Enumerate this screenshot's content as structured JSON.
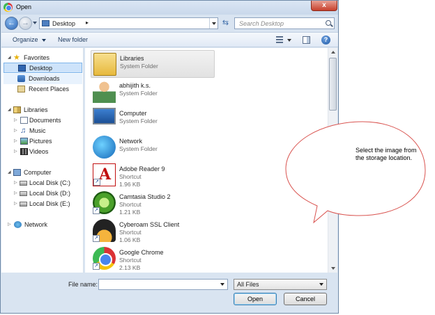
{
  "window": {
    "title": "Open",
    "close_label": "x"
  },
  "address": {
    "path": "Desktop",
    "chevron": "▸",
    "search_placeholder": "Search Desktop"
  },
  "toolbar": {
    "organize_label": "Organize",
    "new_folder_label": "New folder",
    "help_label": "?"
  },
  "nav": {
    "favorites": "Favorites",
    "desktop": "Desktop",
    "downloads": "Downloads",
    "recent": "Recent Places",
    "libraries": "Libraries",
    "documents": "Documents",
    "music": "Music",
    "pictures": "Pictures",
    "videos": "Videos",
    "computer": "Computer",
    "disk_c": "Local Disk (C:)",
    "disk_d": "Local Disk (D:)",
    "disk_e": "Local Disk (E:)",
    "network": "Network"
  },
  "files": [
    {
      "name": "Libraries",
      "type": "System Folder",
      "size": "",
      "icon": "libraries-folder-icon"
    },
    {
      "name": "abhijith k.s.",
      "type": "System Folder",
      "size": "",
      "icon": "user-folder-icon"
    },
    {
      "name": "Computer",
      "type": "System Folder",
      "size": "",
      "icon": "computer-icon"
    },
    {
      "name": "Network",
      "type": "System Folder",
      "size": "",
      "icon": "network-globe-icon"
    },
    {
      "name": "Adobe Reader 9",
      "type": "Shortcut",
      "size": "1.96 KB",
      "icon": "adobe-reader-icon"
    },
    {
      "name": "Camtasia Studio 2",
      "type": "Shortcut",
      "size": "1.21 KB",
      "icon": "camtasia-icon"
    },
    {
      "name": "Cyberoam SSL Client",
      "type": "Shortcut",
      "size": "1.06 KB",
      "icon": "cyberoam-icon"
    },
    {
      "name": "Google Chrome",
      "type": "Shortcut",
      "size": "2.13 KB",
      "icon": "chrome-icon"
    }
  ],
  "bottom": {
    "filename_label": "File name:",
    "filename_value": "",
    "filetype_value": "All Files",
    "open_label": "Open",
    "cancel_label": "Cancel"
  },
  "annotation": {
    "text": "Select the image from the storage location."
  }
}
